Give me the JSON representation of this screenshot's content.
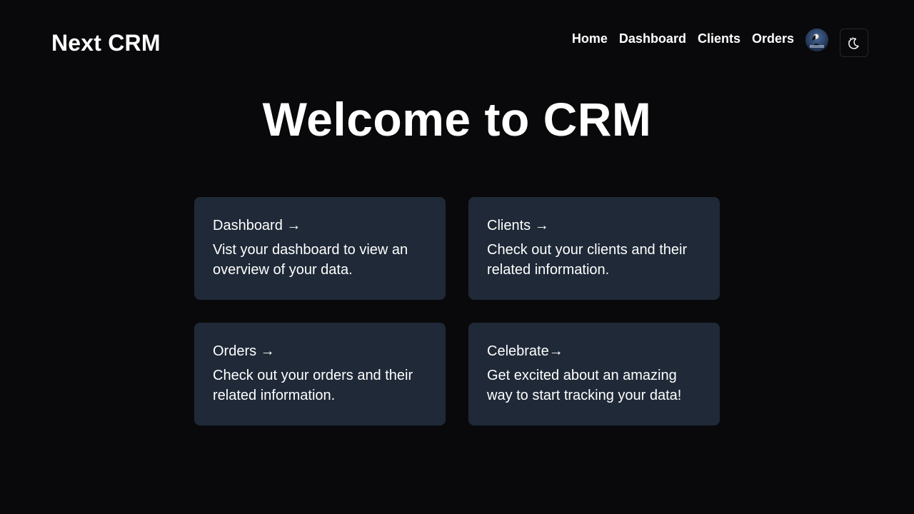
{
  "header": {
    "brand": "Next CRM",
    "nav": [
      {
        "label": "Home"
      },
      {
        "label": "Dashboard"
      },
      {
        "label": "Clients"
      },
      {
        "label": "Orders"
      }
    ],
    "avatar_icon": "user-avatar",
    "theme_toggle_icon": "moon-stars-icon"
  },
  "hero": {
    "title": "Welcome to CRM"
  },
  "cards": [
    {
      "title": "Dashboard →",
      "description": "Vist your dashboard to view an overview of your data."
    },
    {
      "title": "Clients →",
      "description": "Check out your clients and their related information."
    },
    {
      "title": "Orders →",
      "description": "Check out your orders and their related information."
    },
    {
      "title": "Celebrate→",
      "description": "Get excited about an amazing way to start tracking your data!"
    }
  ],
  "colors": {
    "background": "#09090b",
    "card": "#1f2937",
    "text": "#ffffff",
    "border": "#27272a"
  }
}
